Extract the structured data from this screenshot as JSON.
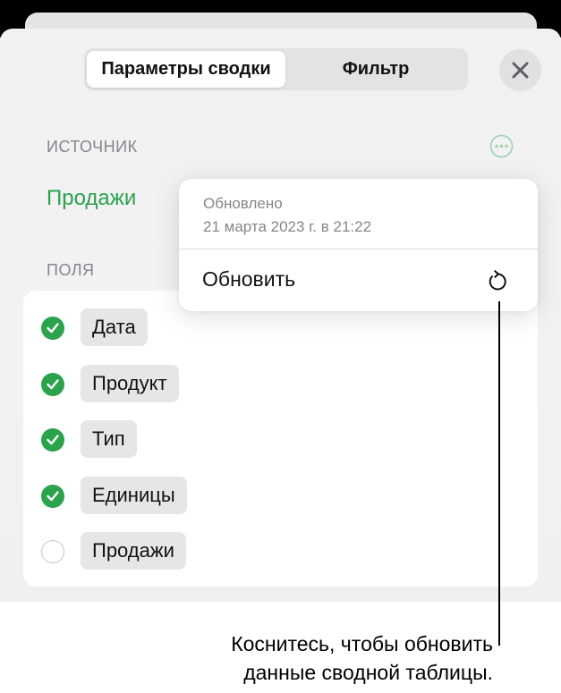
{
  "tabs": [
    {
      "label": "Параметры сводки",
      "active": true
    },
    {
      "label": "Фильтр",
      "active": false
    }
  ],
  "close_icon": "close-icon",
  "source": {
    "header": "ИСТОЧНИК",
    "name": "Продажи",
    "more_icon": "ellipsis-circle-icon"
  },
  "fields": {
    "header": "ПОЛЯ",
    "items": [
      {
        "label": "Дата",
        "checked": true
      },
      {
        "label": "Продукт",
        "checked": true
      },
      {
        "label": "Тип",
        "checked": true
      },
      {
        "label": "Единицы",
        "checked": true
      },
      {
        "label": "Продажи",
        "checked": false
      }
    ]
  },
  "popover": {
    "updated_label": "Обновлено",
    "updated_date": "21 марта 2023 г. в 21:22",
    "refresh_label": "Обновить",
    "refresh_icon": "refresh-icon"
  },
  "callout": {
    "line1": "Коснитесь, чтобы обновить",
    "line2": "данные сводной таблицы."
  },
  "colors": {
    "accent_green": "#2ba24c",
    "secondary_text": "#86868a"
  }
}
